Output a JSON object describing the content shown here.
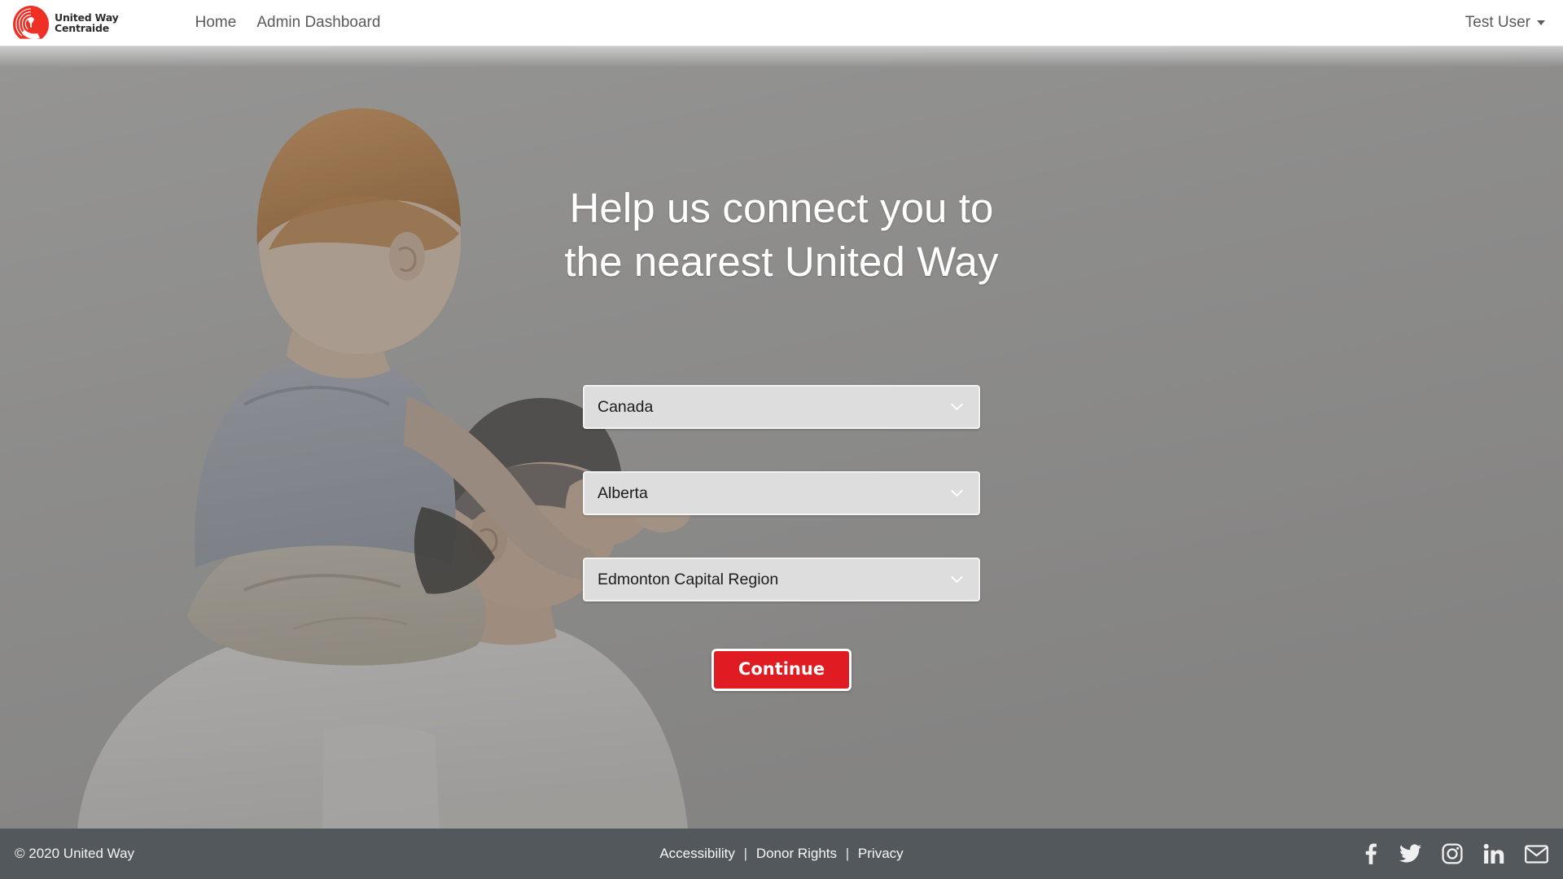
{
  "header": {
    "logo": {
      "icon": "united-way-centraide-logo",
      "line1": "United Way",
      "line2": "Centraide",
      "brand_red": "#ee3124"
    },
    "nav": [
      {
        "label": "Home",
        "name": "nav-link-home"
      },
      {
        "label": "Admin Dashboard",
        "name": "nav-link-admin-dashboard"
      }
    ],
    "user": {
      "label": "Test User",
      "caret_icon": "caret-down-icon"
    }
  },
  "hero": {
    "title_line1": "Help us connect you to",
    "title_line2": "the nearest United Way",
    "overlay_color": "#5a5a5a",
    "photo_alt": "toddler riding on a man's shoulders",
    "selects": [
      {
        "name": "country-select",
        "value": "Canada",
        "chevron_icon": "chevron-down-icon"
      },
      {
        "name": "province-select",
        "value": "Alberta",
        "chevron_icon": "chevron-down-icon"
      },
      {
        "name": "region-select",
        "value": "Edmonton Capital Region",
        "chevron_icon": "chevron-down-icon"
      }
    ],
    "continue_button": {
      "label": "Continue",
      "color": "#e01b22"
    }
  },
  "footer": {
    "copyright": "© 2020 United Way",
    "links": [
      {
        "label": "Accessibility",
        "name": "footer-link-accessibility"
      },
      {
        "label": "Donor Rights",
        "name": "footer-link-donor-rights"
      },
      {
        "label": "Privacy",
        "name": "footer-link-privacy"
      }
    ],
    "separator": "|",
    "social": [
      {
        "name": "facebook-icon",
        "label": "Facebook"
      },
      {
        "name": "twitter-icon",
        "label": "Twitter"
      },
      {
        "name": "instagram-icon",
        "label": "Instagram"
      },
      {
        "name": "linkedin-icon",
        "label": "LinkedIn"
      },
      {
        "name": "email-icon",
        "label": "Email"
      }
    ],
    "background_color": "#53585c"
  }
}
